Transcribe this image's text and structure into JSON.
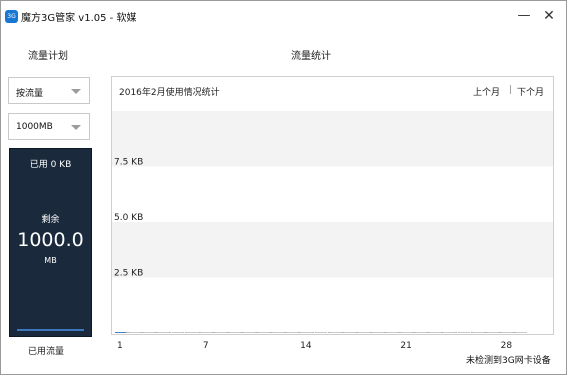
{
  "window": {
    "title": "魔方3G管家 v1.05 - 软媒",
    "app_icon": "app-logo-icon"
  },
  "sidebar": {
    "section_title": "流量计划",
    "mode_select": {
      "value": "按流量"
    },
    "quota_select": {
      "value": "1000MB"
    },
    "gauge": {
      "used_text": "已用 0 KB",
      "remaining_label": "剩余",
      "remaining_value": "1000.0",
      "remaining_unit": "MB",
      "used_fraction": 0
    },
    "footer_label": "已用流量"
  },
  "main": {
    "section_title": "流量统计",
    "chart_header": "2016年2月使用情况统计",
    "prev_month": "上个月",
    "separator": "|",
    "next_month": "下个月",
    "status": "未检测到3G网卡设备"
  },
  "chart_data": {
    "type": "bar",
    "title": "2016年2月使用情况统计",
    "y_tick_labels": [
      "2.5 KB",
      "5.0 KB",
      "7.5 KB"
    ],
    "y_ticks": [
      2.5,
      5.0,
      7.5
    ],
    "ylim": [
      0,
      10
    ],
    "x_tick_labels": [
      "1",
      "7",
      "14",
      "21",
      "28"
    ],
    "x_ticks": [
      1,
      7,
      14,
      21,
      28
    ],
    "xlim": [
      1,
      29
    ],
    "x": [
      1,
      2,
      3,
      4,
      5,
      6,
      7,
      8,
      9,
      10,
      11,
      12,
      13,
      14,
      15,
      16,
      17,
      18,
      19,
      20,
      21,
      22,
      23,
      24,
      25,
      26,
      27,
      28,
      29
    ],
    "values": [
      0,
      0,
      0,
      0,
      0,
      0,
      0,
      0,
      0,
      0,
      0,
      0,
      0,
      0,
      0,
      0,
      0,
      0,
      0,
      0,
      0,
      0,
      0,
      0,
      0,
      0,
      0,
      0,
      0
    ],
    "grid": true,
    "legend": "none"
  },
  "colors": {
    "gauge_bg": "#1a2a3c",
    "accent": "#3f7fc8",
    "band": "#f3f3f3"
  }
}
